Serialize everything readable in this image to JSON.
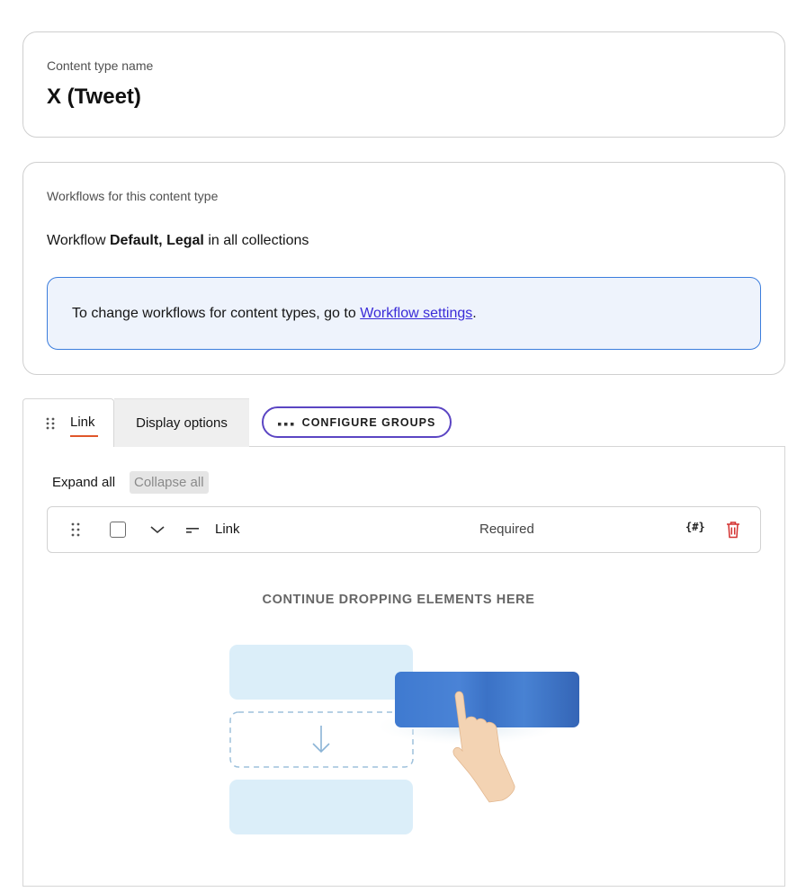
{
  "content_type": {
    "label": "Content type name",
    "name": "X (Tweet)"
  },
  "workflows": {
    "label": "Workflows for this content type",
    "prefix": "Workflow",
    "names": "Default, Legal",
    "suffix": "in all collections",
    "info_prefix": "To change workflows for content types, go to",
    "info_link": "Workflow settings",
    "info_suffix": "."
  },
  "tabs": {
    "link": "Link",
    "display": "Display options"
  },
  "configure_button": "CONFIGURE GROUPS",
  "toolbar": {
    "expand": "Expand all",
    "collapse": "Collapse all"
  },
  "element_row": {
    "label": "Link",
    "status": "Required",
    "code_icon": "{#}"
  },
  "drop_zone": {
    "title": "CONTINUE DROPPING ELEMENTS HERE"
  },
  "colors": {
    "accent": "#5b45c3",
    "tab_underline": "#e0562a",
    "info_border": "#3b7ddd",
    "info_bg": "#eef3fc",
    "link": "#3a2bd8",
    "trash": "#d3302f"
  }
}
